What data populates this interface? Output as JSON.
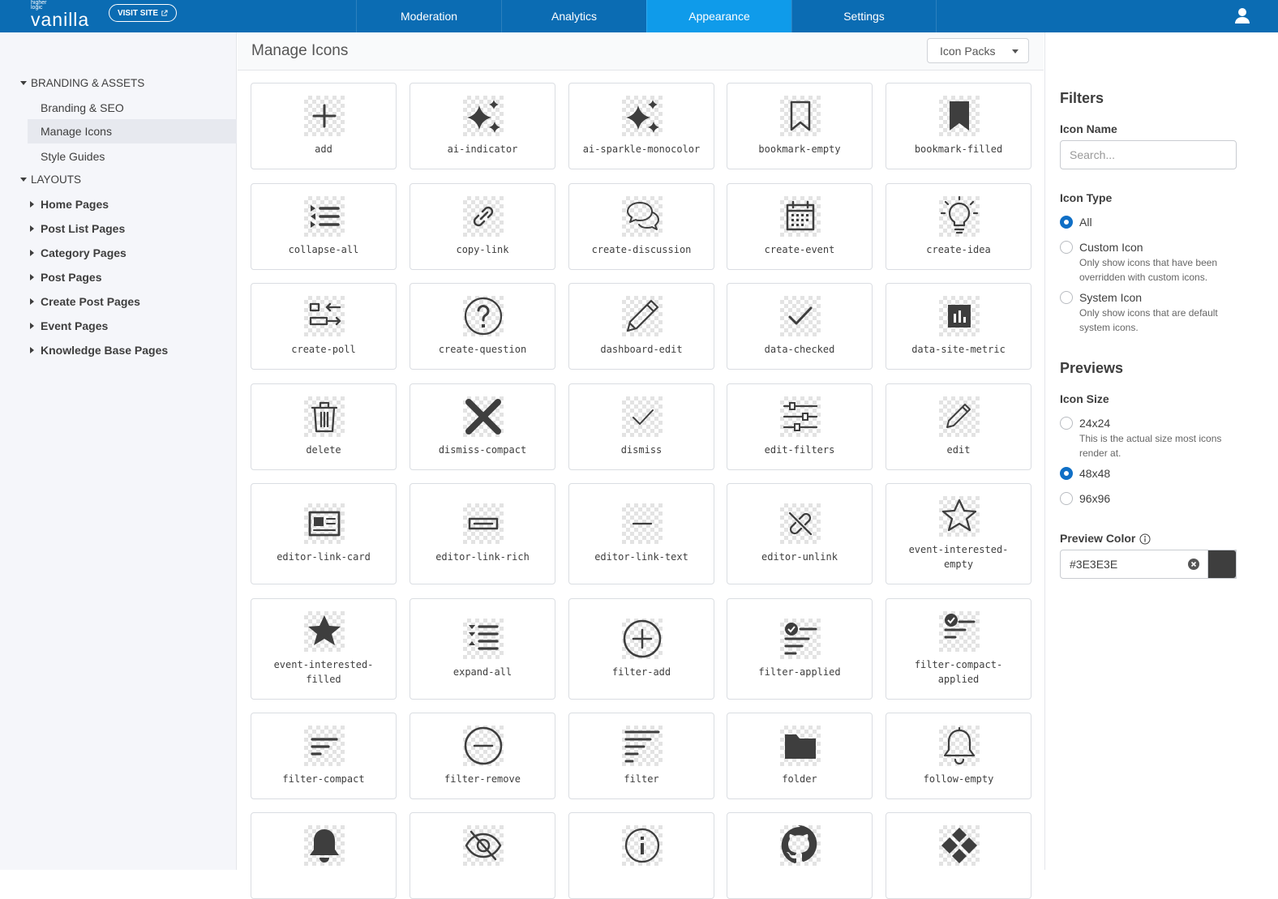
{
  "brand": {
    "small": "higher logic",
    "name": "vanilla",
    "visit_site": "VISIT SITE"
  },
  "nav": {
    "tabs": [
      {
        "label": "Moderation",
        "active": false
      },
      {
        "label": "Analytics",
        "active": false
      },
      {
        "label": "Appearance",
        "active": true
      },
      {
        "label": "Settings",
        "active": false
      }
    ]
  },
  "sidebar": {
    "branding_section": "BRANDING & ASSETS",
    "branding_items": [
      "Branding & SEO",
      "Manage Icons",
      "Style Guides"
    ],
    "selected": "Manage Icons",
    "layouts_section": "LAYOUTS",
    "layout_items": [
      "Home Pages",
      "Post List Pages",
      "Category Pages",
      "Post Pages",
      "Create Post Pages",
      "Event Pages",
      "Knowledge Base Pages"
    ]
  },
  "main": {
    "title": "Manage Icons",
    "icon_packs_label": "Icon Packs"
  },
  "icons": [
    {
      "label": "add",
      "icon": "add-icon"
    },
    {
      "label": "ai-indicator",
      "icon": "ai-indicator-icon"
    },
    {
      "label": "ai-sparkle-monocolor",
      "icon": "ai-sparkle-monocolor-icon"
    },
    {
      "label": "bookmark-empty",
      "icon": "bookmark-empty-icon"
    },
    {
      "label": "bookmark-filled",
      "icon": "bookmark-filled-icon"
    },
    {
      "label": "collapse-all",
      "icon": "collapse-all-icon"
    },
    {
      "label": "copy-link",
      "icon": "copy-link-icon"
    },
    {
      "label": "create-discussion",
      "icon": "create-discussion-icon"
    },
    {
      "label": "create-event",
      "icon": "create-event-icon"
    },
    {
      "label": "create-idea",
      "icon": "create-idea-icon"
    },
    {
      "label": "create-poll",
      "icon": "create-poll-icon"
    },
    {
      "label": "create-question",
      "icon": "create-question-icon"
    },
    {
      "label": "dashboard-edit",
      "icon": "dashboard-edit-icon"
    },
    {
      "label": "data-checked",
      "icon": "data-checked-icon"
    },
    {
      "label": "data-site-metric",
      "icon": "data-site-metric-icon"
    },
    {
      "label": "delete",
      "icon": "delete-icon"
    },
    {
      "label": "dismiss-compact",
      "icon": "dismiss-compact-icon"
    },
    {
      "label": "dismiss",
      "icon": "dismiss-icon"
    },
    {
      "label": "edit-filters",
      "icon": "edit-filters-icon"
    },
    {
      "label": "edit",
      "icon": "edit-icon"
    },
    {
      "label": "editor-link-card",
      "icon": "editor-link-card-icon"
    },
    {
      "label": "editor-link-rich",
      "icon": "editor-link-rich-icon"
    },
    {
      "label": "editor-link-text",
      "icon": "editor-link-text-icon"
    },
    {
      "label": "editor-unlink",
      "icon": "editor-unlink-icon"
    },
    {
      "label": "event-interested-\nempty",
      "icon": "event-interested-empty-icon"
    },
    {
      "label": "event-interested-\nfilled",
      "icon": "event-interested-filled-icon"
    },
    {
      "label": "expand-all",
      "icon": "expand-all-icon"
    },
    {
      "label": "filter-add",
      "icon": "filter-add-icon"
    },
    {
      "label": "filter-applied",
      "icon": "filter-applied-icon"
    },
    {
      "label": "filter-compact-\napplied",
      "icon": "filter-compact-applied-icon"
    },
    {
      "label": "filter-compact",
      "icon": "filter-compact-icon"
    },
    {
      "label": "filter-remove",
      "icon": "filter-remove-icon"
    },
    {
      "label": "filter",
      "icon": "filter-icon"
    },
    {
      "label": "folder",
      "icon": "folder-icon"
    },
    {
      "label": "follow-empty",
      "icon": "follow-empty-icon"
    },
    {
      "label": "",
      "icon": "follow-filled-icon"
    },
    {
      "label": "",
      "icon": "hide-icon"
    },
    {
      "label": "",
      "icon": "info-icon"
    },
    {
      "label": "",
      "icon": "github-icon"
    },
    {
      "label": "",
      "icon": "jira-icon"
    }
  ],
  "filters": {
    "heading": "Filters",
    "icon_name_label": "Icon Name",
    "search_placeholder": "Search...",
    "icon_type_label": "Icon Type",
    "type_options": [
      {
        "label": "All",
        "desc": "",
        "checked": true
      },
      {
        "label": "Custom Icon",
        "desc": "Only show icons that have been overridden with custom icons.",
        "checked": false
      },
      {
        "label": "System Icon",
        "desc": "Only show icons that are default system icons.",
        "checked": false
      }
    ]
  },
  "previews": {
    "heading": "Previews",
    "icon_size_label": "Icon Size",
    "size_options": [
      {
        "label": "24x24",
        "desc": "This is the actual size most icons render at.",
        "checked": false
      },
      {
        "label": "48x48",
        "desc": "",
        "checked": true
      },
      {
        "label": "96x96",
        "desc": "",
        "checked": false
      }
    ],
    "color_label": "Preview Color",
    "color_value": "#3E3E3E"
  },
  "colors": {
    "brand": "#0b6cb3",
    "active_tab": "#0f9bea",
    "icon": "#3e3e3e",
    "radio": "#0f6fc6"
  }
}
